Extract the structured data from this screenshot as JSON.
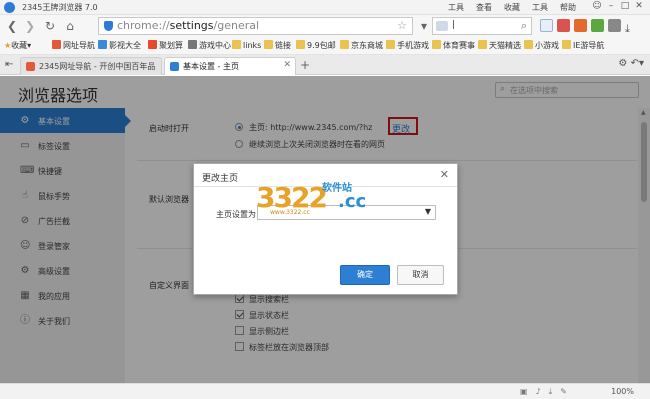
{
  "window": {
    "title": "2345王牌浏览器 7.0",
    "menus": [
      "工具",
      "查看",
      "收藏",
      "工具",
      "帮助"
    ]
  },
  "nav": {
    "url_prefix": "chrome://",
    "url_host": "settings",
    "url_path": "/general",
    "search_placeholder": "|"
  },
  "bookmarks": [
    {
      "label": "收藏",
      "icon": "star-icon"
    },
    {
      "label": "网址导航",
      "icon": "site-icon"
    },
    {
      "label": "影视大全",
      "icon": "video-icon"
    },
    {
      "label": "聚划算",
      "icon": "deal-icon"
    },
    {
      "label": "游戏中心",
      "icon": "game-icon"
    },
    {
      "label": "links",
      "icon": "folder-icon"
    },
    {
      "label": "链接",
      "icon": "folder-icon"
    },
    {
      "label": "9.9包邮",
      "icon": "folder-icon"
    },
    {
      "label": "京东商城",
      "icon": "folder-icon"
    },
    {
      "label": "手机游戏",
      "icon": "folder-icon"
    },
    {
      "label": "体育赛事",
      "icon": "folder-icon"
    },
    {
      "label": "天猫精选",
      "icon": "folder-icon"
    },
    {
      "label": "小游戏",
      "icon": "folder-icon"
    },
    {
      "label": "IE游导航",
      "icon": "folder-icon"
    }
  ],
  "tabs": [
    {
      "label": "2345网址导航 - 开创中国百年品",
      "active": false
    },
    {
      "label": "基本设置 - 主页",
      "active": true
    }
  ],
  "page": {
    "title": "浏览器选项",
    "search_placeholder": "在选项中搜索"
  },
  "sidebar": [
    {
      "label": "基本设置",
      "icon": "gear-icon",
      "glyph": "⚙",
      "active": true
    },
    {
      "label": "标签设置",
      "icon": "tab-icon",
      "glyph": "▭",
      "active": false
    },
    {
      "label": "快捷键",
      "icon": "keyboard-icon",
      "glyph": "⌨",
      "active": false
    },
    {
      "label": "鼠标手势",
      "icon": "mouse-icon",
      "glyph": "☝",
      "active": false
    },
    {
      "label": "广告拦截",
      "icon": "block-icon",
      "glyph": "⊘",
      "active": false
    },
    {
      "label": "登录管家",
      "icon": "login-icon",
      "glyph": "☺",
      "active": false
    },
    {
      "label": "高级设置",
      "icon": "advanced-icon",
      "glyph": "⚙",
      "active": false
    },
    {
      "label": "我的应用",
      "icon": "apps-icon",
      "glyph": "▦",
      "active": false
    },
    {
      "label": "关于我们",
      "icon": "info-icon",
      "glyph": "ⓘ",
      "active": false
    }
  ],
  "startup": {
    "label": "启动时打开",
    "homepage_option": "主页: http://www.2345.com/?hz",
    "change_button": "更改",
    "continue_option": "继续浏览上次关闭浏览器时在看的网页"
  },
  "default_browser": {
    "label": "默认浏览器"
  },
  "custom_ui": {
    "label": "自定义界面",
    "options": [
      {
        "label": "显示搜索栏",
        "checked": true
      },
      {
        "label": "显示状态栏",
        "checked": true
      },
      {
        "label": "显示侧边栏",
        "checked": false
      },
      {
        "label": "标签栏放在浏览器顶部",
        "checked": false
      }
    ]
  },
  "dialog": {
    "title": "更改主页",
    "field_label": "主页设置为",
    "select_value": "",
    "ok_label": "确定",
    "cancel_label": "取消"
  },
  "watermark": {
    "number": "3322",
    "domain_suffix": ".cc",
    "site_name": "软件站",
    "sub": "www.3322.cc"
  },
  "status": {
    "zoom": "100%"
  },
  "colors": {
    "accent": "#2d7fd3",
    "highlight_border": "#c8171e"
  }
}
